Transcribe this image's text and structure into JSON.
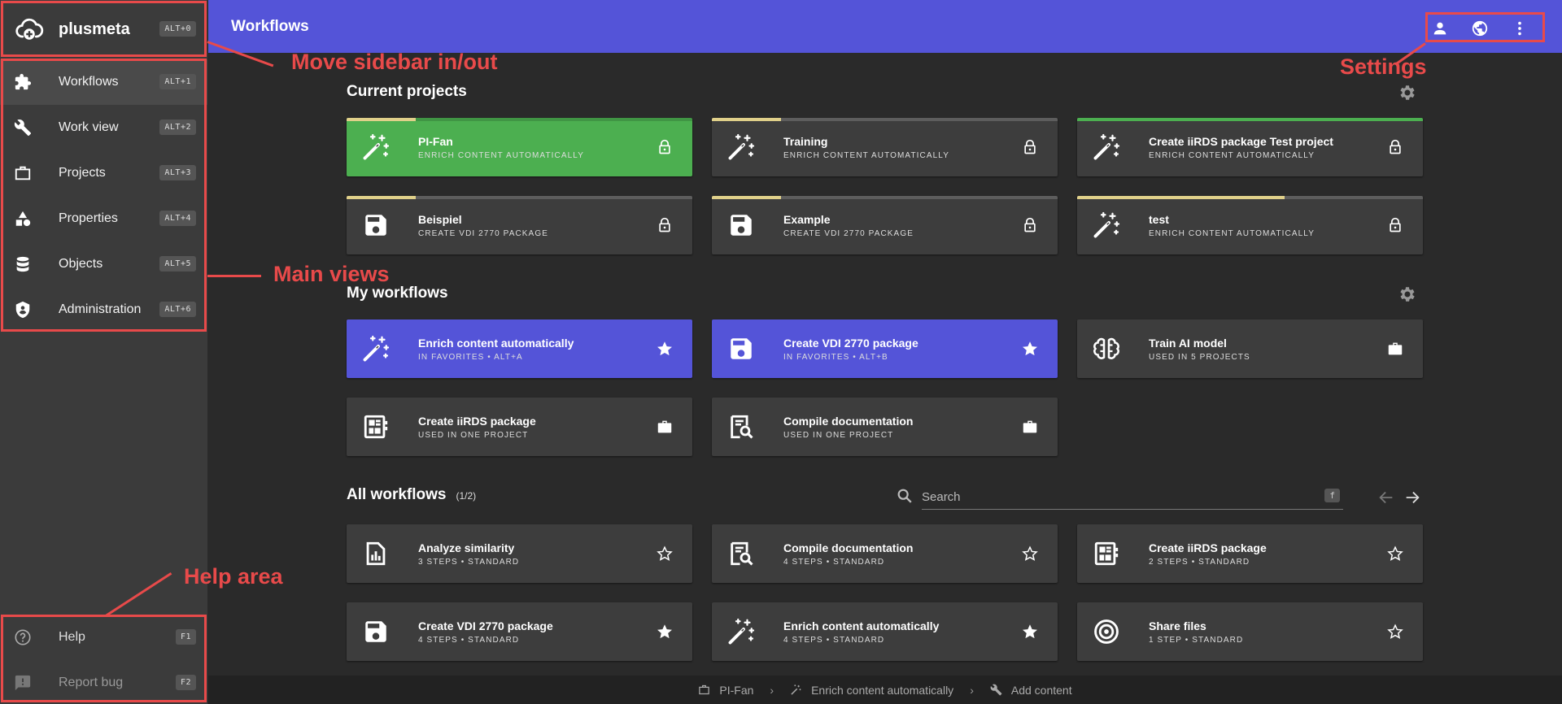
{
  "brand": {
    "name": "plusmeta",
    "shortcut": "ALT+0"
  },
  "sidebar": {
    "items": [
      {
        "label": "Workflows",
        "shortcut": "ALT+1",
        "icon": "puzzle-icon",
        "active": true
      },
      {
        "label": "Work view",
        "shortcut": "ALT+2",
        "icon": "wrench-icon"
      },
      {
        "label": "Projects",
        "shortcut": "ALT+3",
        "icon": "briefcase-icon"
      },
      {
        "label": "Properties",
        "shortcut": "ALT+4",
        "icon": "shapes-icon"
      },
      {
        "label": "Objects",
        "shortcut": "ALT+5",
        "icon": "database-icon"
      },
      {
        "label": "Administration",
        "shortcut": "ALT+6",
        "icon": "shield-icon"
      }
    ],
    "help": [
      {
        "label": "Help",
        "shortcut": "F1",
        "icon": "help-circle-icon"
      },
      {
        "label": "Report bug",
        "shortcut": "F2",
        "icon": "report-icon"
      }
    ]
  },
  "header": {
    "title": "Workflows",
    "icons": [
      "account-icon",
      "globe-icon",
      "more-vert-icon"
    ]
  },
  "annotations": {
    "sidebar_toggle": "Move sidebar in/out",
    "settings": "Settings",
    "main_views": "Main views",
    "help_area": "Help area"
  },
  "current_projects": {
    "title": "Current projects",
    "cards": [
      {
        "title": "PI-Fan",
        "subtitle": "ENRICH CONTENT AUTOMATICALLY",
        "icon": "magic-wand-icon",
        "action": "lock-icon",
        "progress": 0.2,
        "progress_color": "#e0d08a",
        "style": "green"
      },
      {
        "title": "Training",
        "subtitle": "ENRICH CONTENT AUTOMATICALLY",
        "icon": "magic-wand-icon",
        "action": "lock-icon",
        "progress": 0.2,
        "progress_color": "#e0d08a"
      },
      {
        "title": "Create iiRDS package Test project",
        "subtitle": "ENRICH CONTENT AUTOMATICALLY",
        "icon": "magic-wand-icon",
        "action": "lock-icon",
        "progress": 1.0,
        "progress_color": "#4caf50"
      },
      {
        "title": "Beispiel",
        "subtitle": "CREATE VDI 2770 PACKAGE",
        "icon": "save-icon",
        "action": "lock-icon",
        "progress": 0.2,
        "progress_color": "#e0d08a"
      },
      {
        "title": "Example",
        "subtitle": "CREATE VDI 2770 PACKAGE",
        "icon": "save-icon",
        "action": "lock-icon",
        "progress": 0.2,
        "progress_color": "#e0d08a"
      },
      {
        "title": "test",
        "subtitle": "ENRICH CONTENT AUTOMATICALLY",
        "icon": "magic-wand-icon",
        "action": "lock-icon",
        "progress": 0.6,
        "progress_color": "#e0d08a"
      }
    ]
  },
  "my_workflows": {
    "title": "My workflows",
    "cards": [
      {
        "title": "Enrich content automatically",
        "subtitle": "IN FAVORITES • ALT+A",
        "icon": "magic-wand-icon",
        "action": "star-filled-icon",
        "style": "blue"
      },
      {
        "title": "Create VDI 2770 package",
        "subtitle": "IN FAVORITES • ALT+B",
        "icon": "save-icon",
        "action": "star-filled-icon",
        "style": "blue"
      },
      {
        "title": "Train AI model",
        "subtitle": "USED IN 5 PROJECTS",
        "icon": "brain-icon",
        "action": "briefcase-filled-icon"
      },
      {
        "title": "Create iiRDS package",
        "subtitle": "USED IN ONE PROJECT",
        "icon": "package-icon",
        "action": "briefcase-filled-icon"
      },
      {
        "title": "Compile documentation",
        "subtitle": "USED IN ONE PROJECT",
        "icon": "doc-search-icon",
        "action": "briefcase-filled-icon"
      }
    ]
  },
  "all_workflows": {
    "title": "All workflows",
    "count": "(1/2)",
    "search_placeholder": "Search",
    "search_key": "f",
    "cards": [
      {
        "title": "Analyze similarity",
        "subtitle": "3 STEPS • STANDARD",
        "icon": "chart-doc-icon",
        "action": "star-outline-icon"
      },
      {
        "title": "Compile documentation",
        "subtitle": "4 STEPS • STANDARD",
        "icon": "doc-search-icon",
        "action": "star-outline-icon"
      },
      {
        "title": "Create iiRDS package",
        "subtitle": "2 STEPS • STANDARD",
        "icon": "package-icon",
        "action": "star-outline-icon"
      },
      {
        "title": "Create VDI 2770 package",
        "subtitle": "4 STEPS • STANDARD",
        "icon": "save-icon",
        "action": "star-filled-icon"
      },
      {
        "title": "Enrich content automatically",
        "subtitle": "4 STEPS • STANDARD",
        "icon": "magic-wand-icon",
        "action": "star-filled-icon"
      },
      {
        "title": "Share files",
        "subtitle": "1 STEP • STANDARD",
        "icon": "target-icon",
        "action": "star-outline-icon"
      }
    ]
  },
  "breadcrumb": [
    {
      "label": "PI-Fan",
      "icon": "briefcase-icon"
    },
    {
      "label": "Enrich content automatically",
      "icon": "magic-wand-icon"
    },
    {
      "label": "Add content",
      "icon": "wrench-icon"
    }
  ]
}
